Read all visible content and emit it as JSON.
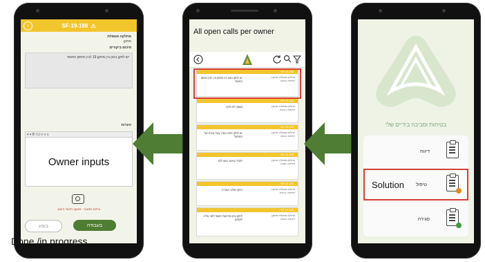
{
  "left_phone": {
    "header_title": "SF-19-188",
    "back_icon": "back-arrow-icon",
    "warning_icon": "warning-icon",
    "field1_label": "מחלקה מטפלת",
    "field1_value": "מתקן",
    "field2_label": "סיכום ביקורים",
    "description": "יש לתקן בטון בין מתקן 19 לבין מחסן החומר",
    "notes_label": "הערות",
    "owner_inputs_label": "Owner inputs",
    "red_note": "צילום תמונה - מעקב תיעוד ביצוע",
    "button_done": "בוצע",
    "button_in_progress": "בעבודה",
    "caption": "Done /in progress"
  },
  "middle_phone": {
    "title": "All open calls per owner",
    "cards": [
      {
        "code": "SF-19-188",
        "desc": "יש לתקן בטון בין מתקן 19 לבין מחסן החומר",
        "meta": "מחלקה מטפלת: מתקן | דחיפות: גבוהה"
      },
      {
        "code": "SF-19-190",
        "desc": "מעקה לא תקין",
        "meta": "מחלקה מטפלת: מתקן | דחיפות: בינונית"
      },
      {
        "code": "SF-19-191",
        "desc": "יש לתקן פתח בגדר בצד מזרח של המפעל",
        "meta": "מחלקה מטפלת: מתקן | דחיפות: גבוהה"
      },
      {
        "code": "SF-19-193",
        "desc": "תקרה באזור טעון לקוי",
        "meta": "מחלקה מטפלת: מתקן | דחיפות: נמוכה"
      },
      {
        "code": "SF-19-195",
        "desc": "תיקון שלטי אזהרה",
        "meta": "מחלקה מטפלת: מתקן | דחיפות: בינונית"
      },
      {
        "code": "SF-19-199",
        "desc": "לתקן גרם מדרגות חשוף לפני עליה למתקן",
        "meta": "מחלקה מטפלת: מתקן | דחיפות: גבוהה"
      }
    ]
  },
  "right_phone": {
    "tagline": "בטיחות וסביבה בידיים שלי",
    "menu": [
      {
        "label": "דיווח",
        "icon": "clipboard-edit-icon"
      },
      {
        "label": "טיפול",
        "icon": "clipboard-alert-icon",
        "annotation": "Solution"
      },
      {
        "label": "סגירה",
        "icon": "clipboard-check-icon"
      }
    ]
  },
  "colors": {
    "accent_yellow": "#f3c52d",
    "green": "#4e7d33",
    "highlight_red": "#d53f3a"
  }
}
